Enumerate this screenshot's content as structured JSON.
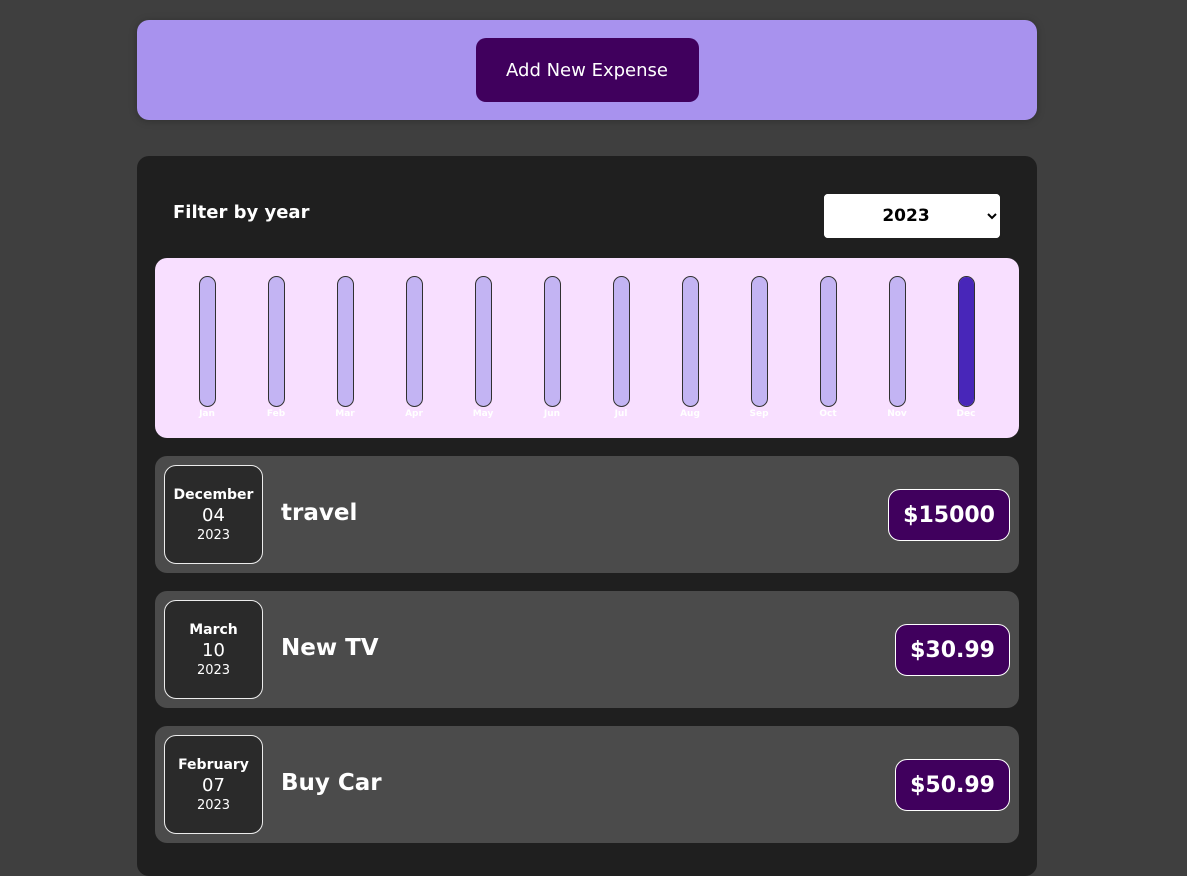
{
  "new_expense": {
    "add_label": "Add New Expense"
  },
  "filter": {
    "label": "Filter by year",
    "selected_year": "2023",
    "options": [
      "2023"
    ]
  },
  "chart_data": {
    "type": "bar",
    "categories": [
      "Jan",
      "Feb",
      "Mar",
      "Apr",
      "May",
      "Jun",
      "Jul",
      "Aug",
      "Sep",
      "Oct",
      "Nov",
      "Dec"
    ],
    "values": [
      50.99,
      0,
      30.99,
      0,
      0,
      0,
      0,
      0,
      0,
      0,
      0,
      15000
    ],
    "ylim": [
      0,
      15000
    ],
    "colors": {
      "empty": "#c3b4f3",
      "fill": "#4826b9",
      "background": "#f8dfff"
    }
  },
  "expenses": [
    {
      "month": "December",
      "day": "04",
      "year": "2023",
      "title": "travel",
      "amount": "$15000"
    },
    {
      "month": "March",
      "day": "10",
      "year": "2023",
      "title": "New TV",
      "amount": "$30.99"
    },
    {
      "month": "February",
      "day": "07",
      "year": "2023",
      "title": "Buy Car",
      "amount": "$50.99"
    }
  ],
  "colors": {
    "accent": "#40005d",
    "header_bg": "#a892ee",
    "page_bg": "#3f3f3f"
  }
}
